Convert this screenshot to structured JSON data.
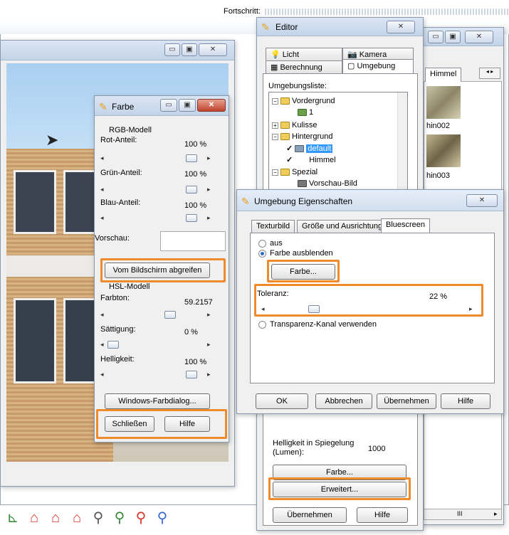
{
  "progress_label": "Fortschritt:",
  "editor": {
    "title": "Editor",
    "tabs_top": [
      "Licht",
      "Kamera"
    ],
    "tabs_bottom": [
      "Berechnung",
      "Umgebung"
    ],
    "list_label": "Umgebungsliste:",
    "tree": [
      {
        "label": "Vordergrund"
      },
      {
        "label": "1"
      },
      {
        "label": "Kulisse"
      },
      {
        "label": "Hintergrund"
      },
      {
        "label": "default"
      },
      {
        "label": "Himmel"
      },
      {
        "label": "Spezial"
      },
      {
        "label": "Vorschau-Bild"
      }
    ],
    "helligkeit_label": "Helligkeit in Spiegelung (Lumen):",
    "helligkeit_value": "1000",
    "farbe_button": "Farbe...",
    "erweitert_button": "Erweitert...",
    "uebernehmen_button": "Übernehmen",
    "hilfe_button": "Hilfe"
  },
  "thumbs_panel": {
    "tab": "Himmel",
    "items": [
      "hin002",
      "hin003"
    ],
    "scroll_mark": "III"
  },
  "farbe": {
    "title": "Farbe",
    "rgb_label": "RGB-Modell",
    "rot_label": "Rot-Anteil:",
    "rot_value": "100 %",
    "gruen_label": "Grün-Anteil:",
    "gruen_value": "100 %",
    "blau_label": "Blau-Anteil:",
    "blau_value": "100 %",
    "vorschau_label": "Vorschau:",
    "grab_button": "Vom Bildschirm abgreifen",
    "hsl_label": "HSL-Modell",
    "farbton_label": "Farbton:",
    "farbton_value": "59.2157",
    "saettigung_label": "Sättigung:",
    "saettigung_value": "0 %",
    "helligkeit_label": "Helligkeit:",
    "helligkeit_value": "100 %",
    "windows_button": "Windows-Farbdialog...",
    "close_button": "Schließen",
    "help_button": "Hilfe"
  },
  "props": {
    "title": "Umgebung Eigenschaften",
    "tabs": [
      "Texturbild",
      "Größe und Ausrichtung",
      "Bluescreen"
    ],
    "radio_aus": "aus",
    "radio_farbe": "Farbe ausblenden",
    "farbe_button": "Farbe...",
    "toleranz_label": "Toleranz:",
    "toleranz_value": "22 %",
    "transparenz_label": "Transparenz-Kanal verwenden",
    "ok": "OK",
    "abbrechen": "Abbrechen",
    "uebernehmen": "Übernehmen",
    "hilfe": "Hilfe"
  },
  "colors": {
    "highlight": "#ef8b2d",
    "accent": "#3399ff"
  }
}
